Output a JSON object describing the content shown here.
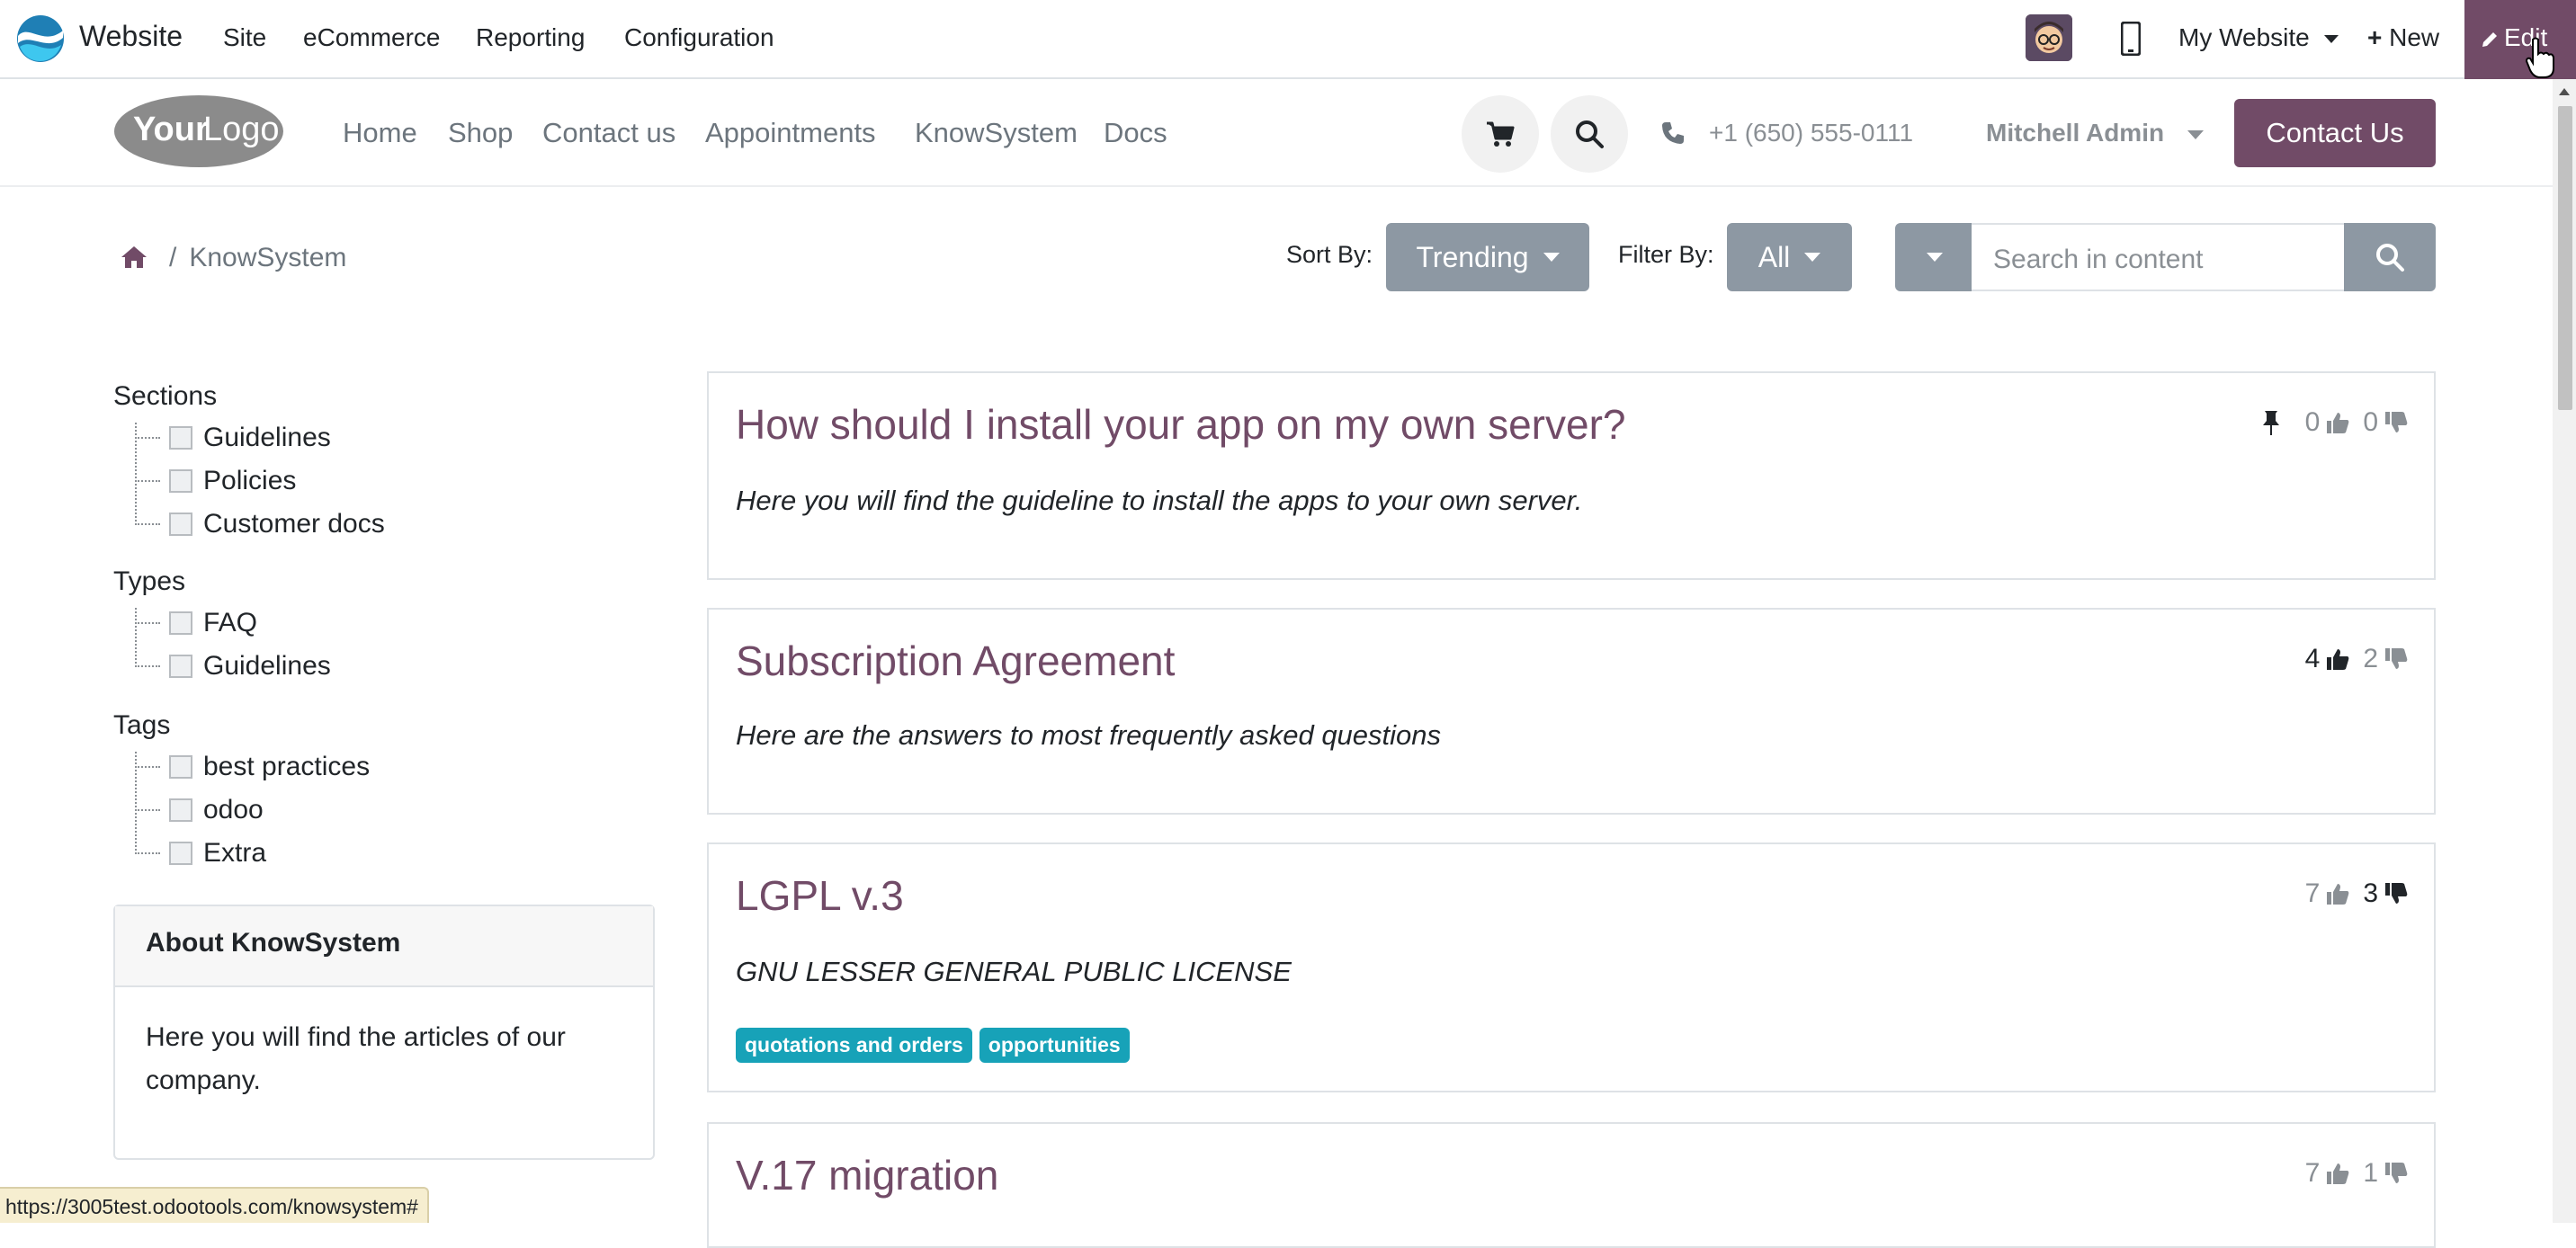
{
  "admin_bar": {
    "app_name": "Website",
    "menus": [
      "Site",
      "eCommerce",
      "Reporting",
      "Configuration"
    ],
    "website_selector": "My Website",
    "new_label": "New",
    "edit_label": "Edit"
  },
  "site_header": {
    "logo_text": "YourLogo",
    "nav": [
      "Home",
      "Shop",
      "Contact us",
      "Appointments",
      "KnowSystem",
      "Docs"
    ],
    "phone": "+1 (650) 555-0111",
    "user": "Mitchell Admin",
    "contact_button": "Contact Us"
  },
  "toolbar": {
    "breadcrumb_current": "KnowSystem",
    "breadcrumb_sep": "/",
    "sort_label": "Sort By:",
    "sort_value": "Trending",
    "filter_label": "Filter By:",
    "filter_value": "All",
    "search_placeholder": "Search in content"
  },
  "sidebar": {
    "sections_title": "Sections",
    "sections": [
      "Guidelines",
      "Policies",
      "Customer docs"
    ],
    "types_title": "Types",
    "types": [
      "FAQ",
      "Guidelines"
    ],
    "tags_title": "Tags",
    "tags": [
      "best practices",
      "odoo",
      "Extra"
    ],
    "about_title": "About KnowSystem",
    "about_text": "Here you will find the articles of our company."
  },
  "articles": [
    {
      "title": "How should I install your app on my own server?",
      "description": "Here you will find the guideline to install the apps to your own server.",
      "likes": "0",
      "dislikes": "0",
      "pinned": true,
      "tags": []
    },
    {
      "title": "Subscription Agreement",
      "description": "Here are the answers to most frequently asked questions",
      "likes": "4",
      "dislikes": "2",
      "pinned": false,
      "tags": []
    },
    {
      "title": "LGPL v.3",
      "description": "GNU LESSER GENERAL PUBLIC LICENSE",
      "likes": "7",
      "dislikes": "3",
      "pinned": false,
      "tags": [
        "quotations and orders",
        "opportunities"
      ]
    },
    {
      "title": "V.17 migration",
      "description": "",
      "likes": "7",
      "dislikes": "1",
      "pinned": false,
      "tags": []
    }
  ],
  "status_url": "https://3005test.odootools.com/knowsystem#",
  "colors": {
    "primary": "#714b67",
    "secondary": "#8d98a3",
    "tag": "#17a2b8"
  }
}
